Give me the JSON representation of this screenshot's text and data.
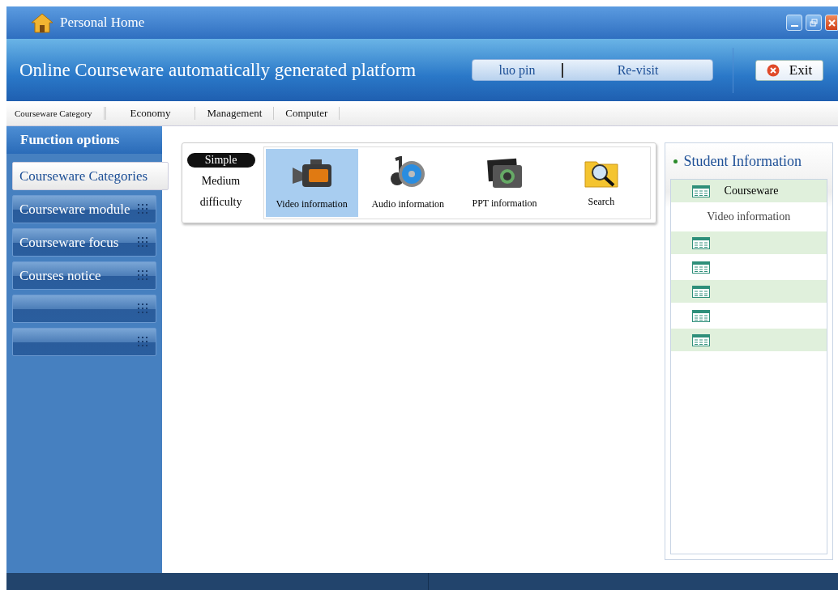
{
  "window": {
    "title": "Personal Home"
  },
  "header": {
    "title": "Online Courseware automatically generated platform",
    "user": "luo pin",
    "revisit": "Re-visit",
    "exit": "Exit"
  },
  "nav": [
    "Courseware Category",
    "Economy",
    "Management",
    "Computer"
  ],
  "sidebar": {
    "title": "Function options",
    "items": [
      {
        "label": "Courseware Categories",
        "selected": true
      },
      {
        "label": "Courseware module",
        "selected": false
      },
      {
        "label": "Courseware focus",
        "selected": false
      },
      {
        "label": "Courses notice",
        "selected": false
      },
      {
        "selected": false
      },
      {
        "selected": false
      }
    ]
  },
  "difficulty": [
    {
      "label": "Simple",
      "selected": true
    },
    {
      "label": "Medium difficulty",
      "selected": false
    }
  ],
  "tools": [
    {
      "label": "Video information",
      "kind": "video",
      "selected": true
    },
    {
      "label": "Audio information",
      "kind": "audio",
      "selected": false
    },
    {
      "label": "PPT information",
      "kind": "ppt",
      "selected": false
    },
    {
      "label": "Search",
      "kind": "search",
      "selected": false
    }
  ],
  "student_info": {
    "title": "Student Information",
    "rows": [
      {
        "kind": "icon",
        "label": "Courseware"
      },
      {
        "kind": "text",
        "label": "Video information"
      },
      {
        "kind": "icon"
      },
      {
        "kind": "icon"
      },
      {
        "kind": "icon"
      },
      {
        "kind": "icon"
      },
      {
        "kind": "icon"
      }
    ]
  }
}
